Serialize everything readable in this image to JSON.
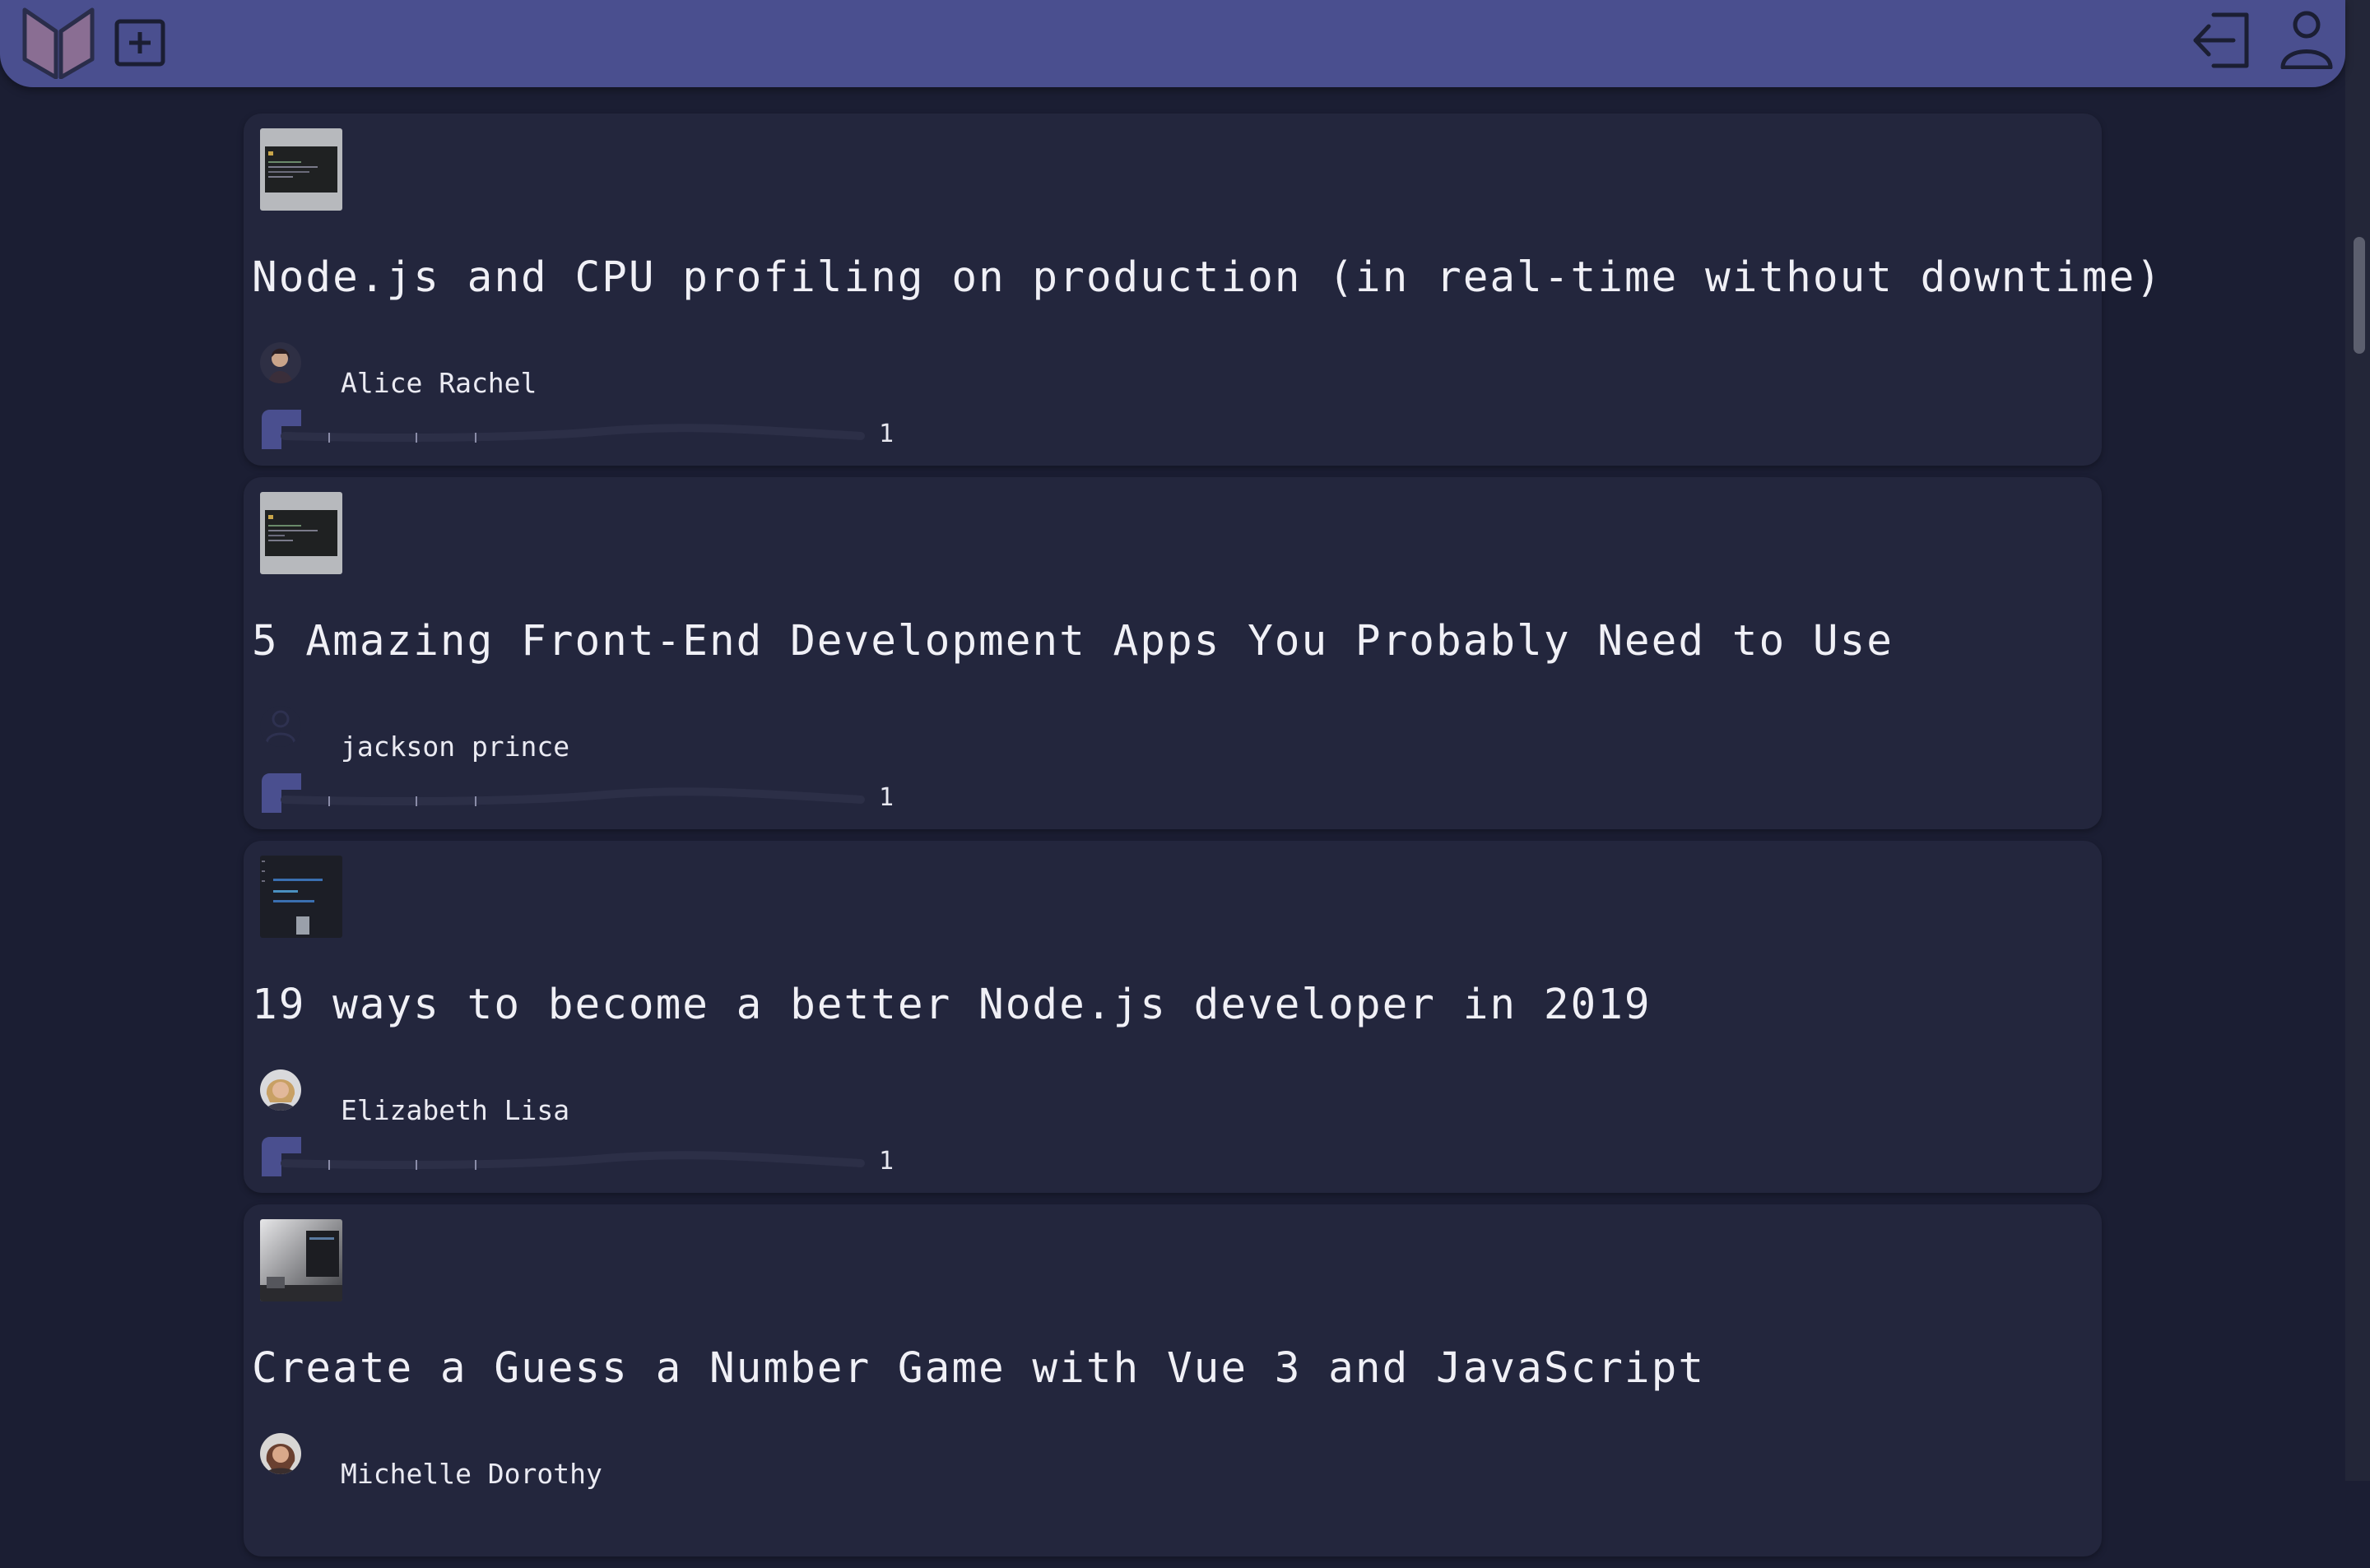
{
  "header": {
    "logo_icon": "book-logo-icon",
    "add_icon": "plus-square-icon",
    "logout_icon": "logout-icon",
    "profile_icon": "user-icon",
    "colors": {
      "bar": "#4a4f8f",
      "background": "#1b1e33",
      "card": "#23263d"
    }
  },
  "posts": [
    {
      "title": "Node.js and CPU profiling on production (in real-time without downtime)",
      "author": "Alice Rachel",
      "claps": "1",
      "thumb_icon": "code-screenshot-thumbnail",
      "avatar_icon": "author-photo-avatar"
    },
    {
      "title": "5 Amazing Front-End Development Apps You Probably Need to Use",
      "author": "jackson prince",
      "claps": "1",
      "thumb_icon": "code-screenshot-thumbnail",
      "avatar_icon": "default-user-avatar"
    },
    {
      "title": "19 ways to become a better Node.js developer in 2019",
      "author": "Elizabeth Lisa",
      "claps": "1",
      "thumb_icon": "code-editor-thumbnail",
      "avatar_icon": "author-photo-avatar"
    },
    {
      "title": "Create a Guess a Number Game with Vue 3 and JavaScript",
      "author": "Michelle Dorothy",
      "claps": "",
      "thumb_icon": "desk-photo-thumbnail",
      "avatar_icon": "author-photo-avatar"
    }
  ]
}
